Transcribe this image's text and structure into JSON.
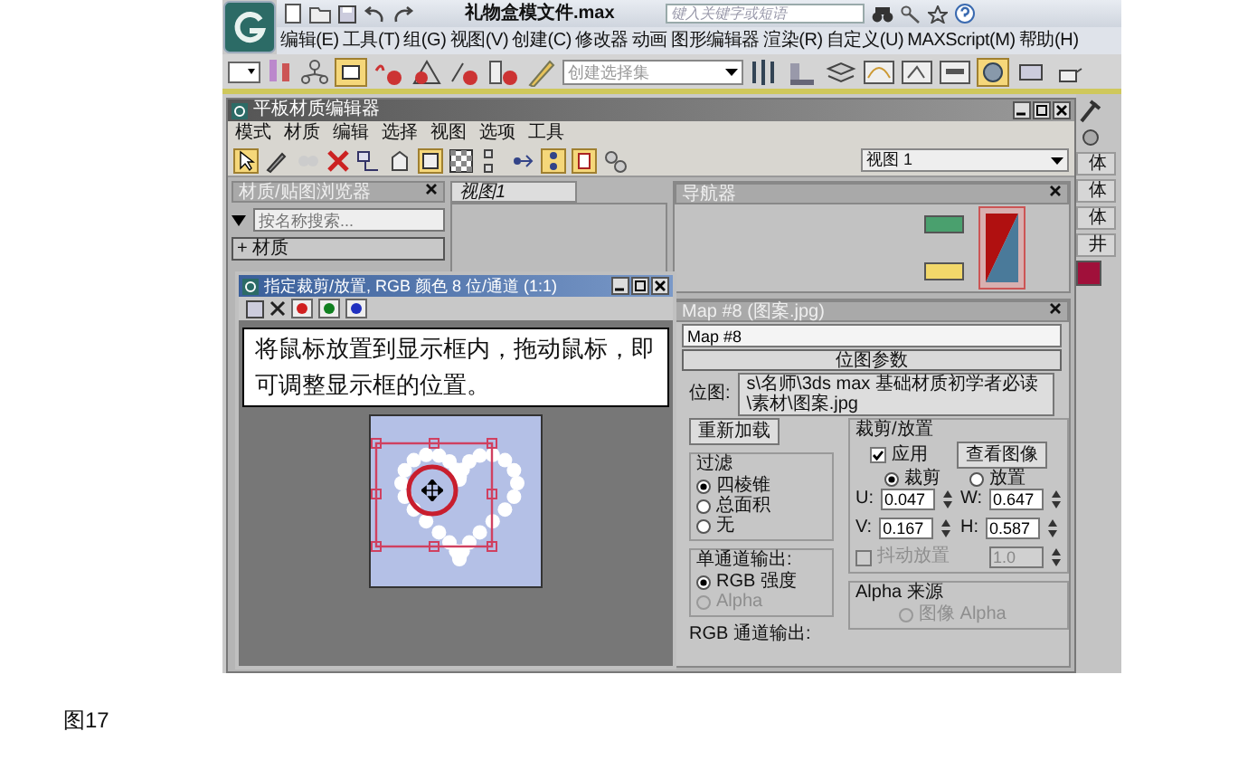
{
  "app": {
    "title": "礼物盒模文件.max",
    "search_placeholder": "键入关键字或短语"
  },
  "menu": [
    "编辑(E)",
    "工具(T)",
    "组(G)",
    "视图(V)",
    "创建(C)",
    "修改器",
    "动画",
    "图形编辑器",
    "渲染(R)",
    "自定义(U)",
    "MAXScript(M)",
    "帮助(H)"
  ],
  "toolbar": {
    "selection_set": "创建选择集"
  },
  "editor": {
    "title": "平板材质编辑器",
    "menu": [
      "模式",
      "材质",
      "编辑",
      "选择",
      "视图",
      "选项",
      "工具"
    ],
    "browser": {
      "title": "材质/贴图浏览器",
      "search_placeholder": "按名称搜索...",
      "groups": [
        "+ 材质"
      ]
    },
    "view_tab": "视图1",
    "view_dropdown": "视图 1",
    "navigator": {
      "title": "导航器"
    },
    "map_panel": {
      "title": "Map #8 (图案.jpg)",
      "name": "Map #8",
      "rollout": "位图参数",
      "bitmap_label": "位图:",
      "bitmap_path": "s\\名师\\3ds max 基础材质初学者必读\\素材\\图案.jpg",
      "reload": "重新加载",
      "filter": {
        "title": "过滤",
        "options": [
          {
            "label": "四棱锥",
            "selected": true
          },
          {
            "label": "总面积",
            "selected": false
          },
          {
            "label": "无",
            "selected": false
          }
        ]
      },
      "mono": {
        "title": "单通道输出:",
        "options": [
          {
            "label": "RGB 强度",
            "selected": true,
            "disabled": false
          },
          {
            "label": "Alpha",
            "selected": false,
            "disabled": true
          }
        ]
      },
      "rgb_output": "RGB 通道输出:",
      "crop": {
        "title": "裁剪/放置",
        "apply": {
          "label": "应用",
          "checked": true
        },
        "view_image": "查看图像",
        "modes": [
          {
            "label": "裁剪",
            "selected": true
          },
          {
            "label": "放置",
            "selected": false
          }
        ],
        "fields": [
          {
            "label": "U:",
            "value": "0.047"
          },
          {
            "label": "W:",
            "value": "0.647"
          },
          {
            "label": "V:",
            "value": "0.167"
          },
          {
            "label": "H:",
            "value": "0.587"
          }
        ],
        "jitter": {
          "label": "抖动放置",
          "checked": false,
          "disabled": true,
          "value": "1.0"
        }
      },
      "alpha_source": {
        "title": "Alpha 来源",
        "options": [
          {
            "label": "图像 Alpha",
            "selected": false,
            "disabled": true
          }
        ]
      }
    }
  },
  "crop_window": {
    "title": "指定裁剪/放置, RGB 颜色 8 位/通道 (1:1)",
    "callout": "将鼠标放置到显示框内，拖动鼠标，即可调整显示框的位置。"
  },
  "side_strip": [
    "体",
    "体",
    "体",
    "井"
  ],
  "caption": "图17"
}
